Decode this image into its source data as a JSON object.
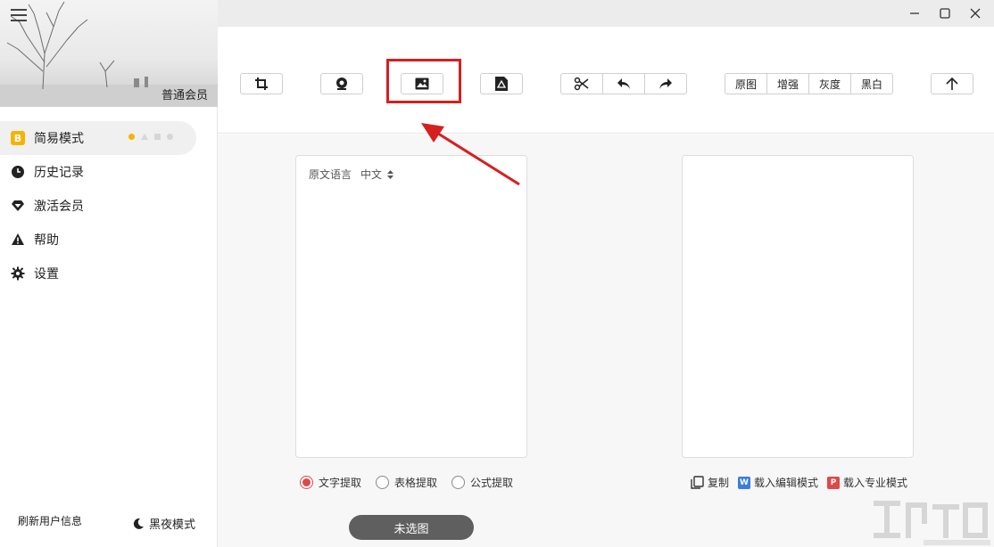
{
  "sidebar": {
    "member_label": "普通会员",
    "nav": [
      {
        "label": "简易模式",
        "icon": "b-badge-icon",
        "active": true
      },
      {
        "label": "历史记录",
        "icon": "clock-icon"
      },
      {
        "label": "激活会员",
        "icon": "diamond-icon"
      },
      {
        "label": "帮助",
        "icon": "warning-icon"
      },
      {
        "label": "设置",
        "icon": "gear-icon"
      }
    ],
    "refresh_label": "刷新用户信息",
    "night_label": "黑夜模式"
  },
  "toolbar": {
    "filters": [
      "原图",
      "增强",
      "灰度",
      "黑白"
    ]
  },
  "left_panel": {
    "source_lang_label": "原文语言",
    "source_lang_value": "中文"
  },
  "extract_modes": [
    {
      "label": "文字提取",
      "selected": true
    },
    {
      "label": "表格提取",
      "selected": false
    },
    {
      "label": "公式提取",
      "selected": false
    }
  ],
  "actions": {
    "copy": "复制",
    "edit_mode": "载入编辑模式",
    "edit_badge": "W",
    "pro_mode": "载入专业模式",
    "pro_badge": "P"
  },
  "bottom_button": "未选图",
  "colors": {
    "accent_yellow": "#f5b400",
    "highlight_red": "#d71f1f",
    "radio_red": "#e04848"
  }
}
